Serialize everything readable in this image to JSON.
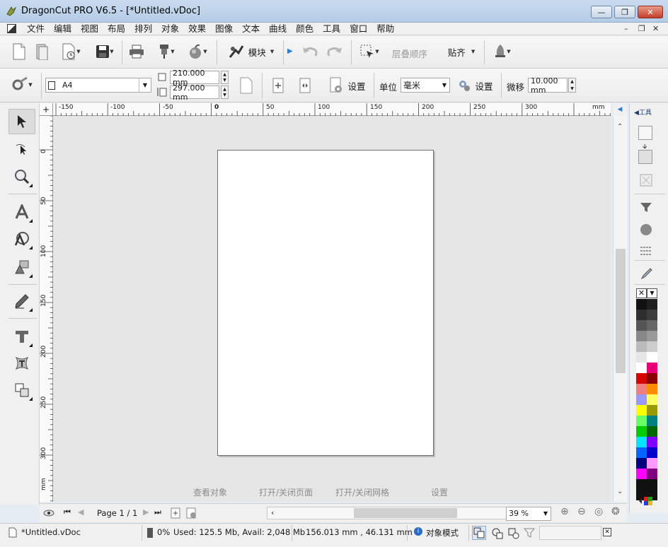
{
  "window": {
    "title": "DragonCut PRO V6.5 - [*Untitled.vDoc]"
  },
  "menu": [
    "文件",
    "编辑",
    "视图",
    "布局",
    "排列",
    "对象",
    "效果",
    "图像",
    "文本",
    "曲线",
    "颜色",
    "工具",
    "窗口",
    "帮助"
  ],
  "toolbar1": {
    "module_label": "模块",
    "layer_order_label": "层叠顺序",
    "snap_label": "贴齐"
  },
  "toolbar2": {
    "page_size": "A4",
    "width": "210.000 mm",
    "height": "297.000 mm",
    "page_settings_label": "设置",
    "unit_label": "单位",
    "unit_value": "毫米",
    "unit_settings_label": "设置",
    "nudge_label": "微移",
    "nudge_value": "10.000 mm"
  },
  "ruler": {
    "top_labels": [
      "-150",
      "-100",
      "-50",
      "0",
      "50",
      "100",
      "150",
      "200",
      "250",
      "300"
    ],
    "top_unit": "mm",
    "left_labels": [
      "0",
      "50",
      "100",
      "150",
      "200",
      "250",
      "300"
    ],
    "left_unit": "mm"
  },
  "canvas_actions": {
    "view_objects": "查看对象",
    "toggle_page": "打开/关闭页面",
    "toggle_grid": "打开/关闭网格",
    "settings": "设置"
  },
  "right_panel": {
    "tab_label": "工具"
  },
  "navigation": {
    "page_label": "Page 1 / 1",
    "zoom": "39 %"
  },
  "status": {
    "filename": "*Untitled.vDoc",
    "memory_pct": "0%",
    "memory": "Used: 125.5 Mb, Avail: 2,048 Mb",
    "coords": "156.013 mm , 46.131 mm",
    "mode": "对象模式"
  },
  "palette": [
    [
      "#111111",
      "#1f1f1f"
    ],
    [
      "#2e2e2e",
      "#3c3c3c"
    ],
    [
      "#555555",
      "#666666"
    ],
    [
      "#888888",
      "#999999"
    ],
    [
      "#bbbbbb",
      "#cccccc"
    ],
    [
      "#e6e6e6",
      "#ffffff"
    ],
    [
      "#ffffff",
      "#e8007a"
    ],
    [
      "#d90000",
      "#8b0000"
    ],
    [
      "#f08080",
      "#ff8c00"
    ],
    [
      "#9999ff",
      "#ffff66"
    ],
    [
      "#ffff00",
      "#999900"
    ],
    [
      "#66ff66",
      "#008080"
    ],
    [
      "#00cc00",
      "#006600"
    ],
    [
      "#00e5ff",
      "#8000ff"
    ],
    [
      "#0066ff",
      "#0000cc"
    ],
    [
      "#000080",
      "#ff99ff"
    ],
    [
      "#ff00ff",
      "#800080"
    ],
    [
      "#111111",
      "#111111"
    ],
    [
      "#111111",
      "#111111"
    ]
  ]
}
